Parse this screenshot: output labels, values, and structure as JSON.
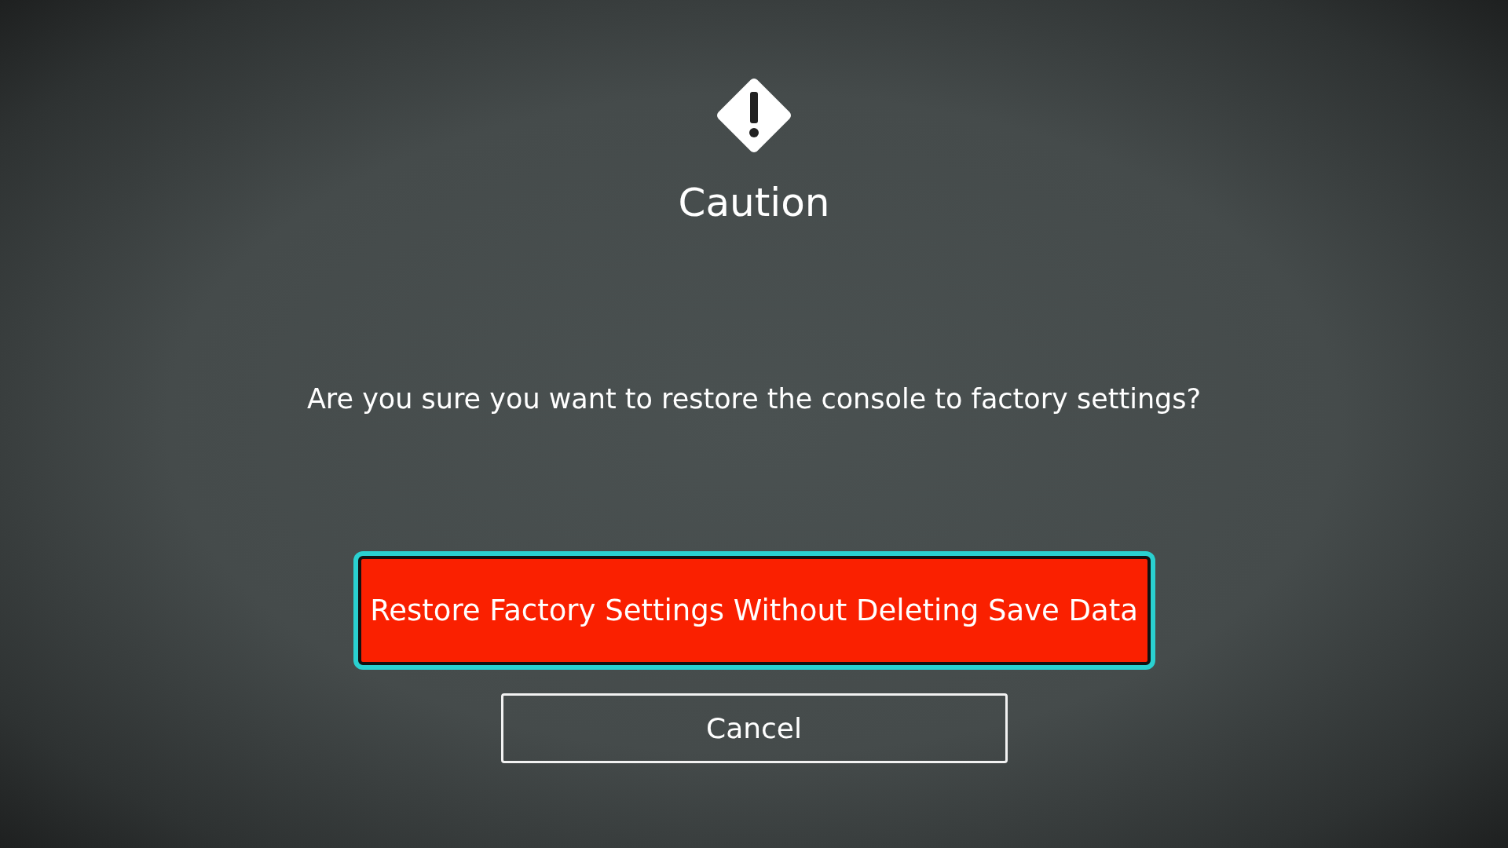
{
  "dialog": {
    "title": "Caution",
    "message": "Are you sure you want to restore the console to factory settings?",
    "buttons": [
      {
        "label": "Restore Factory Settings Without Deleting Save Data",
        "kind": "danger",
        "selected": true
      },
      {
        "label": "Cancel",
        "kind": "outline",
        "selected": false
      }
    ]
  }
}
